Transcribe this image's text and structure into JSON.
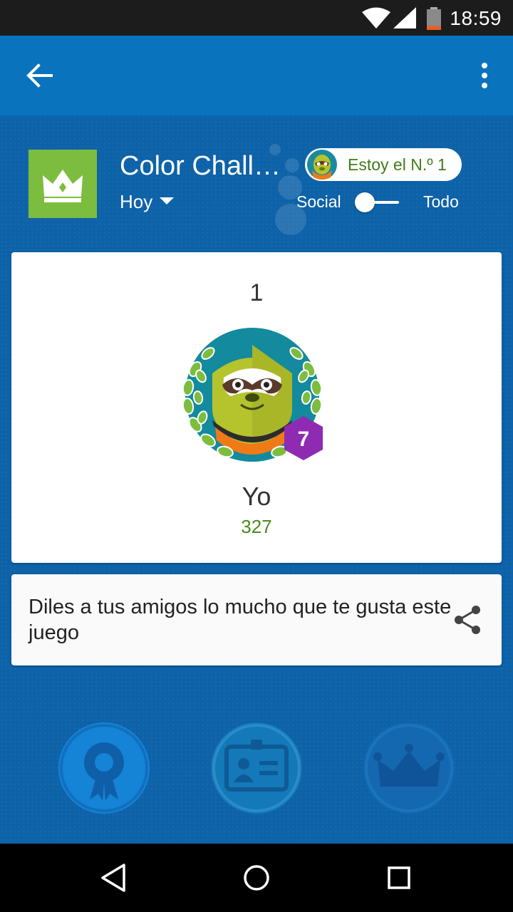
{
  "status_bar": {
    "time": "18:59"
  },
  "app_bar": {
    "back_icon": "arrow-back-icon",
    "menu_icon": "more-vert-icon"
  },
  "game": {
    "title": "Color Challenge",
    "period": "Hoy",
    "icon": "crown-icon"
  },
  "rank_badge": {
    "label": "Estoy el N.º 1"
  },
  "toggle": {
    "left_label": "Social",
    "right_label": "Todo",
    "selected": "Social"
  },
  "leaderboard": {
    "entries": [
      {
        "rank": "1",
        "name": "Yo",
        "score": "327",
        "level": "7"
      }
    ]
  },
  "share": {
    "text": "Diles a tus amigos lo mucho que te gusta este juego",
    "icon": "share-icon"
  },
  "bottom_nav": [
    {
      "icon": "achievements-icon"
    },
    {
      "icon": "profile-card-icon"
    },
    {
      "icon": "leaderboard-crown-icon"
    }
  ],
  "colors": {
    "app_bar": "#0a73bd",
    "background": "#0d62a8",
    "game_icon": "#7cbd3f",
    "accent_green": "#4a8a1e",
    "level_badge": "#8e2bb2"
  }
}
